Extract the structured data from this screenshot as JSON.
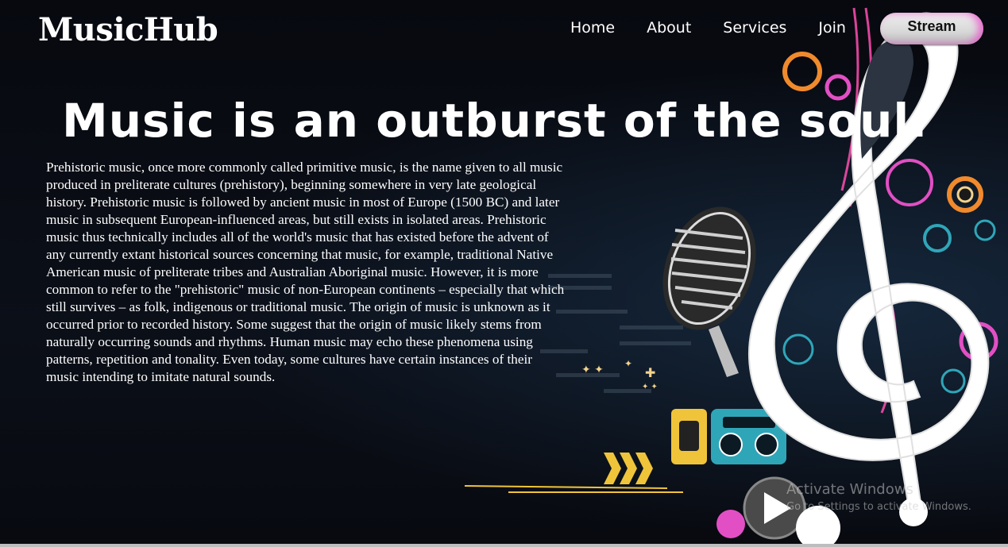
{
  "header": {
    "logo": "MusicHub",
    "nav": [
      "Home",
      "About",
      "Services",
      "Join"
    ],
    "stream_label": "Stream"
  },
  "hero": {
    "headline": "Music is an outburst of the soul.",
    "paragraph": "Prehistoric music, once more commonly called primitive music, is the name given to all music produced in preliterate cultures (prehistory), beginning somewhere in very late geological history. Prehistoric music is followed by ancient music in most of Europe (1500 BC) and later music in subsequent European-influenced areas, but still exists in isolated areas. Prehistoric music thus technically includes all of the world's music that has existed before the advent of any currently extant historical sources concerning that music, for example, traditional Native American music of preliterate tribes and Australian Aboriginal music. However, it is more common to refer to the \"prehistoric\" music of non-European continents – especially that which still survives – as folk, indigenous or traditional music. The origin of music is unknown as it occurred prior to recorded history. Some suggest that the origin of music likely stems from naturally occurring sounds and rhythms. Human music may echo these phenomena using patterns, repetition and tonality. Even today, some cultures have certain instances of their music intending to imitate natural sounds."
  },
  "watermark": {
    "line1": "Activate Windows",
    "line2": "Go to Settings to activate Windows."
  },
  "colors": {
    "background": "#05070c",
    "accent_pink": "#e24fc4",
    "accent_teal": "#2fa6b8",
    "accent_orange": "#f08a2c"
  },
  "background_art": "treble-clef-microphone-boombox-collage"
}
